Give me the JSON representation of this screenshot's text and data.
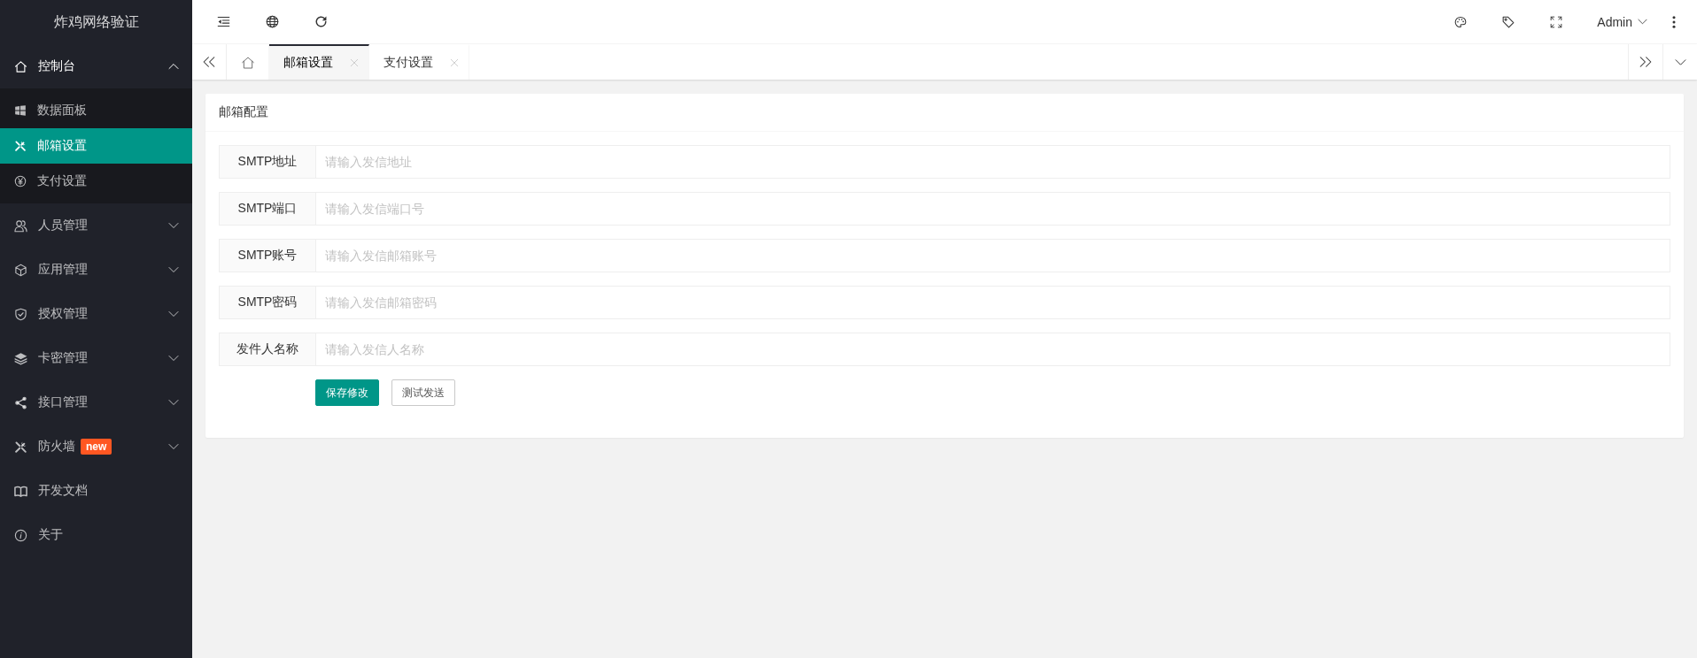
{
  "sidebar": {
    "title": "炸鸡网络验证",
    "menu": [
      {
        "kind": "group",
        "label": "控制台",
        "expanded": true,
        "selected": false,
        "children": [
          {
            "label": "数据面板",
            "selected": false
          },
          {
            "label": "邮箱设置",
            "selected": true
          },
          {
            "label": "支付设置",
            "selected": false
          }
        ]
      },
      {
        "kind": "group",
        "label": "人员管理",
        "expanded": false,
        "selected": false
      },
      {
        "kind": "group",
        "label": "应用管理",
        "expanded": false,
        "selected": false
      },
      {
        "kind": "group",
        "label": "授权管理",
        "expanded": false,
        "selected": false
      },
      {
        "kind": "group",
        "label": "卡密管理",
        "expanded": false,
        "selected": false
      },
      {
        "kind": "group",
        "label": "接口管理",
        "expanded": false,
        "selected": false
      },
      {
        "kind": "group",
        "label": "防火墙",
        "badge": "new",
        "expanded": false,
        "selected": false
      },
      {
        "kind": "link",
        "label": "开发文档",
        "selected": false
      },
      {
        "kind": "link",
        "label": "关于",
        "selected": false
      }
    ]
  },
  "header": {
    "user": "Admin"
  },
  "tabs": [
    {
      "kind": "home",
      "selected": false
    },
    {
      "kind": "page",
      "label": "邮箱设置",
      "selected": true
    },
    {
      "kind": "page",
      "label": "支付设置",
      "selected": false
    }
  ],
  "card": {
    "title": "邮箱配置",
    "fields": [
      {
        "label": "SMTP地址",
        "placeholder": "请输入发信地址"
      },
      {
        "label": "SMTP端口",
        "placeholder": "请输入发信端口号"
      },
      {
        "label": "SMTP账号",
        "placeholder": "请输入发信邮箱账号"
      },
      {
        "label": "SMTP密码",
        "placeholder": "请输入发信邮箱密码"
      },
      {
        "label": "发件人名称",
        "placeholder": "请输入发信人名称"
      }
    ],
    "buttons": [
      {
        "kind": "primary",
        "label": "保存修改"
      },
      {
        "kind": "default",
        "label": "测试发送"
      }
    ]
  }
}
